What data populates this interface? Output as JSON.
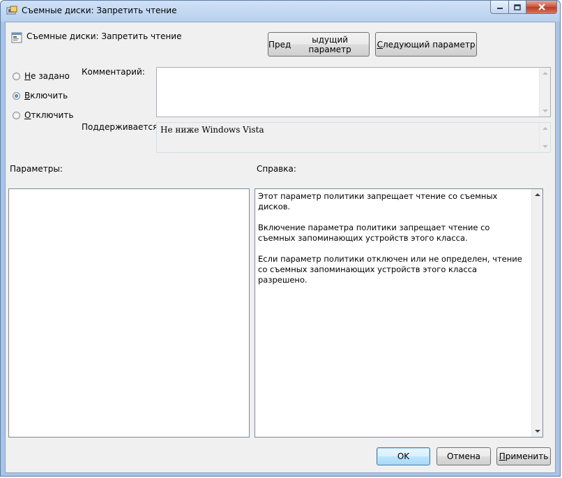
{
  "window": {
    "title": "Съемные диски: Запретить чтение"
  },
  "header": {
    "policy_name": "Съемные диски: Запретить чтение",
    "prev_button": {
      "accel": "д",
      "before": "Пре",
      "after": "ыдущий параметр"
    },
    "next_button": {
      "accel": "С",
      "before": "",
      "after": "ледующий параметр"
    }
  },
  "state": {
    "options": [
      {
        "accel": "Н",
        "rest": "е задано",
        "checked": false
      },
      {
        "accel": "В",
        "rest": "ключить",
        "checked": true
      },
      {
        "accel": "О",
        "rest": "тключить",
        "checked": false
      }
    ]
  },
  "comment": {
    "label": "Комментарий:",
    "value": ""
  },
  "supported": {
    "label": "Поддерживается:",
    "value": "Не ниже Windows Vista"
  },
  "params": {
    "label": "Параметры:"
  },
  "help": {
    "label": "Справка:",
    "paragraphs": [
      "Этот параметр политики запрещает чтение со съемных дисков.",
      "Включение параметра политики запрещает чтение со съемных запоминающих устройств этого класса.",
      "Если параметр политики отключен или не определен, чтение со съемных запоминающих устройств этого класса разрешено."
    ]
  },
  "footer": {
    "ok_label": "OK",
    "cancel_label": "Отмена",
    "apply_button": {
      "accel": "П",
      "rest": "рименить"
    }
  }
}
